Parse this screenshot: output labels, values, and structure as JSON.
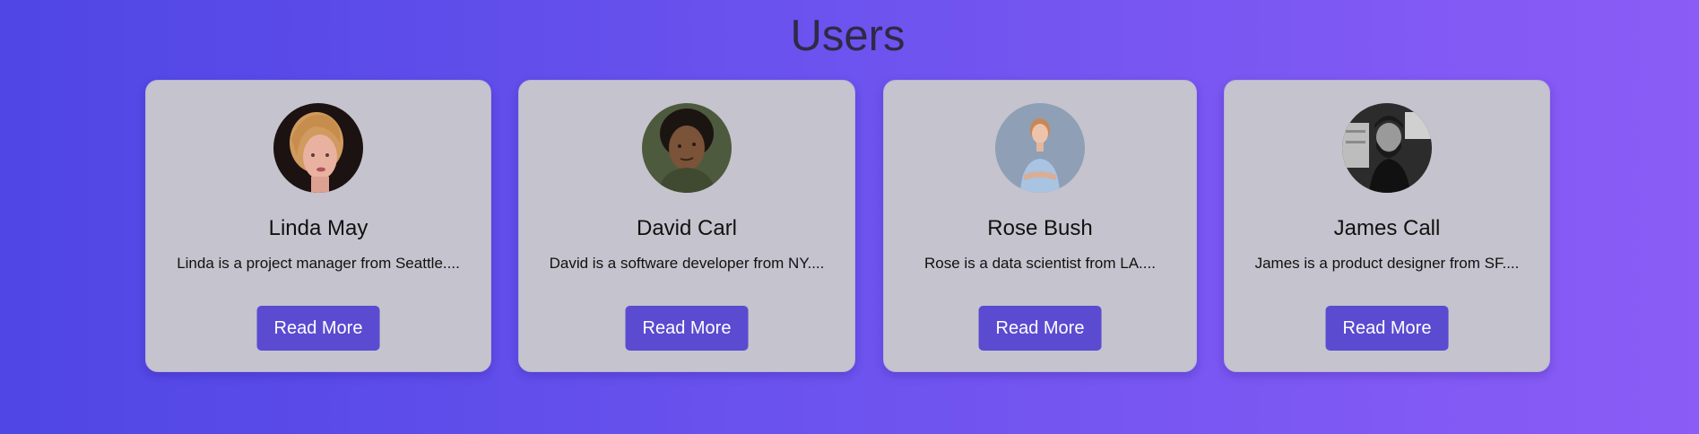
{
  "header": {
    "title": "Users"
  },
  "users": [
    {
      "name": "Linda May",
      "description": "Linda is a project manager from Seattle....",
      "button_label": "Read More"
    },
    {
      "name": "David Carl",
      "description": "David is a software developer from NY....",
      "button_label": "Read More"
    },
    {
      "name": "Rose Bush",
      "description": "Rose is a data scientist from LA....",
      "button_label": "Read More"
    },
    {
      "name": "James Call",
      "description": "James is a product designer from SF....",
      "button_label": "Read More"
    }
  ],
  "colors": {
    "background_start": "#4f46e5",
    "background_end": "#8b5cf6",
    "card": "#c5c3cd",
    "button": "#5a4bd0",
    "title": "#2f2a45"
  }
}
